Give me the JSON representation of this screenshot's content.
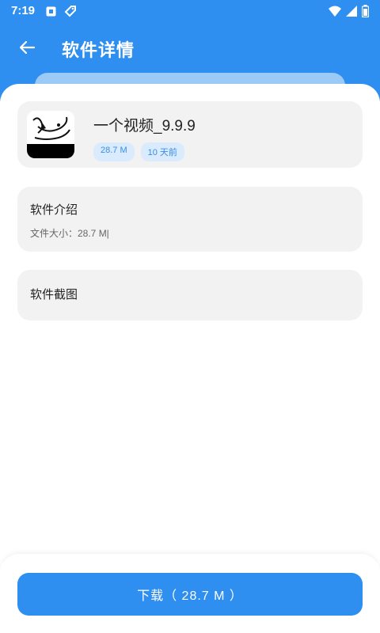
{
  "status_bar": {
    "time": "7:19",
    "left_icons": [
      "notification-square-icon",
      "tag-icon"
    ],
    "right_icons": [
      "wifi-icon",
      "signal-icon",
      "battery-icon"
    ]
  },
  "header": {
    "title": "软件详情",
    "back_icon": "arrow-left-icon"
  },
  "app": {
    "name": "一个视频_9.9.9",
    "size_tag": "28.7 M",
    "time_tag": "10 天前"
  },
  "intro": {
    "title": "软件介绍",
    "file_size": "文件大小：28.7 M|"
  },
  "screenshots": {
    "title": "软件截图"
  },
  "download": {
    "label": "下载（ 28.7 M ）"
  },
  "colors": {
    "primary": "#2e8ff0",
    "tag_bg": "#d9ebfc",
    "card_bg": "#f2f2f2"
  }
}
